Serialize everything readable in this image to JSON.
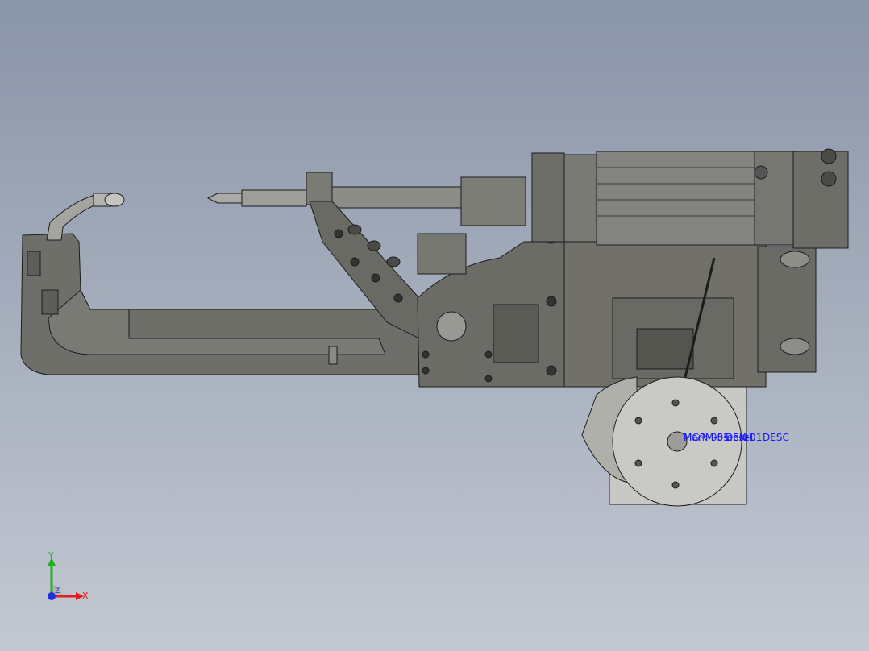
{
  "view": {
    "background_top": "#8a95a8",
    "background_bottom": "#c3c8d2",
    "model_color": "#6f6f6a",
    "edge_color": "#1c1c1c",
    "cylinder_color": "#8d8d88",
    "wheel_color": "#c9c9c6"
  },
  "annotations": {
    "overlap_a": "MGPM-05-EN-01",
    "overlap_b": "Mark-05-en-01",
    "overlap_c": "Desc",
    "overlap_d": "DESC",
    "color": "#1a1aff"
  },
  "triad": {
    "x_label": "X",
    "y_label": "Y",
    "z_label": "Z",
    "x_color": "#e02020",
    "y_color": "#20b020",
    "z_color": "#2030e0"
  }
}
